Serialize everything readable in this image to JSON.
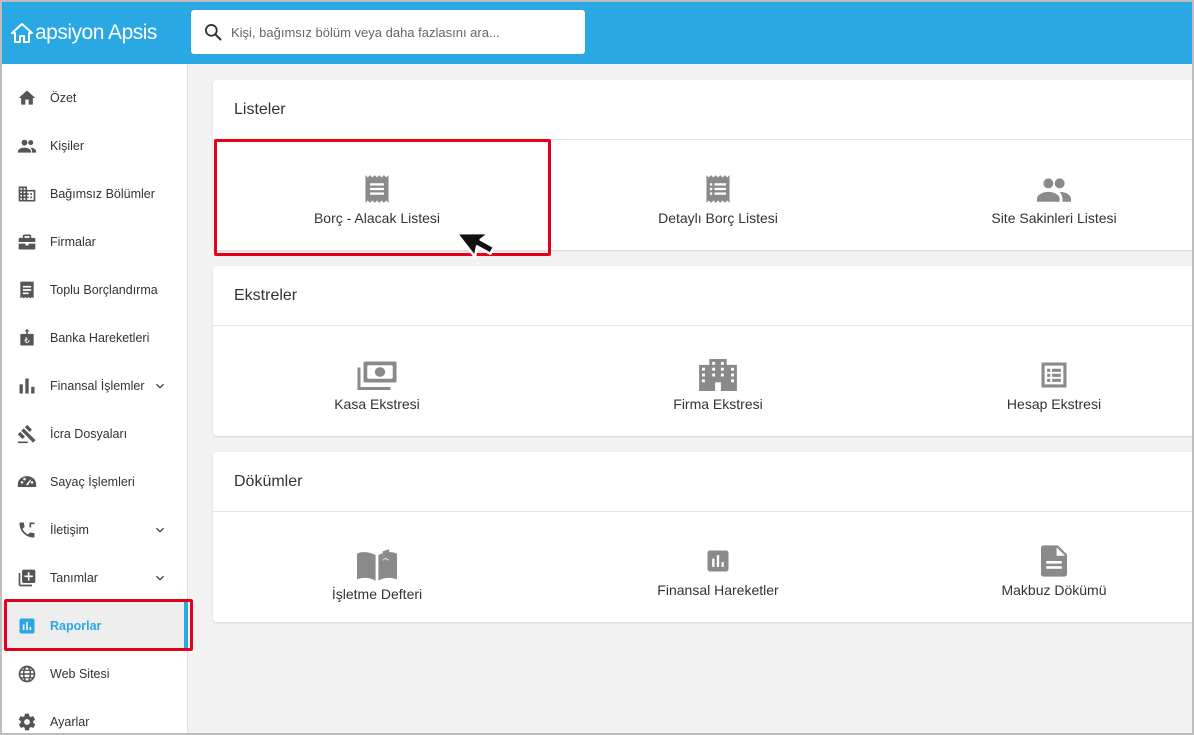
{
  "app": {
    "logo_text": "apsiyon Apsis",
    "brand_color": "#29a8e3",
    "highlight_color": "#e3001b"
  },
  "search": {
    "placeholder": "Kişi, bağımsız bölüm veya daha fazlasını ara..."
  },
  "sidebar": {
    "items": [
      {
        "label": "Özet",
        "icon": "home-icon"
      },
      {
        "label": "Kişiler",
        "icon": "people-icon"
      },
      {
        "label": "Bağımsız Bölümler",
        "icon": "building-icon"
      },
      {
        "label": "Firmalar",
        "icon": "briefcase-icon"
      },
      {
        "label": "Toplu Borçlandırma",
        "icon": "receipt-icon"
      },
      {
        "label": "Banka Hareketleri",
        "icon": "bank-icon"
      },
      {
        "label": "Finansal İşlemler",
        "icon": "bar-chart-icon",
        "expandable": true
      },
      {
        "label": "İcra Dosyaları",
        "icon": "gavel-icon"
      },
      {
        "label": "Sayaç İşlemleri",
        "icon": "meter-icon"
      },
      {
        "label": "İletişim",
        "icon": "phone-icon",
        "expandable": true
      },
      {
        "label": "Tanımlar",
        "icon": "add-box-icon",
        "expandable": true
      },
      {
        "label": "Raporlar",
        "icon": "report-icon",
        "active": true
      },
      {
        "label": "Web Sitesi",
        "icon": "globe-icon"
      },
      {
        "label": "Ayarlar",
        "icon": "gear-icon"
      }
    ]
  },
  "sections": [
    {
      "title": "Listeler",
      "tiles": [
        {
          "label": "Borç - Alacak Listesi",
          "icon": "receipt-list-icon"
        },
        {
          "label": "Detaylı Borç Listesi",
          "icon": "receipt-list-icon"
        },
        {
          "label": "Site Sakinleri Listesi",
          "icon": "people-icon"
        }
      ]
    },
    {
      "title": "Ekstreler",
      "tiles": [
        {
          "label": "Kasa Ekstresi",
          "icon": "money-icon"
        },
        {
          "label": "Firma Ekstresi",
          "icon": "office-building-icon"
        },
        {
          "label": "Hesap Ekstresi",
          "icon": "list-alt-icon"
        }
      ]
    },
    {
      "title": "Dökümler",
      "tiles": [
        {
          "label": "İşletme Defteri",
          "icon": "open-book-icon"
        },
        {
          "label": "Finansal Hareketler",
          "icon": "chart-box-icon"
        },
        {
          "label": "Makbuz Dökümü",
          "icon": "document-icon"
        }
      ]
    }
  ]
}
